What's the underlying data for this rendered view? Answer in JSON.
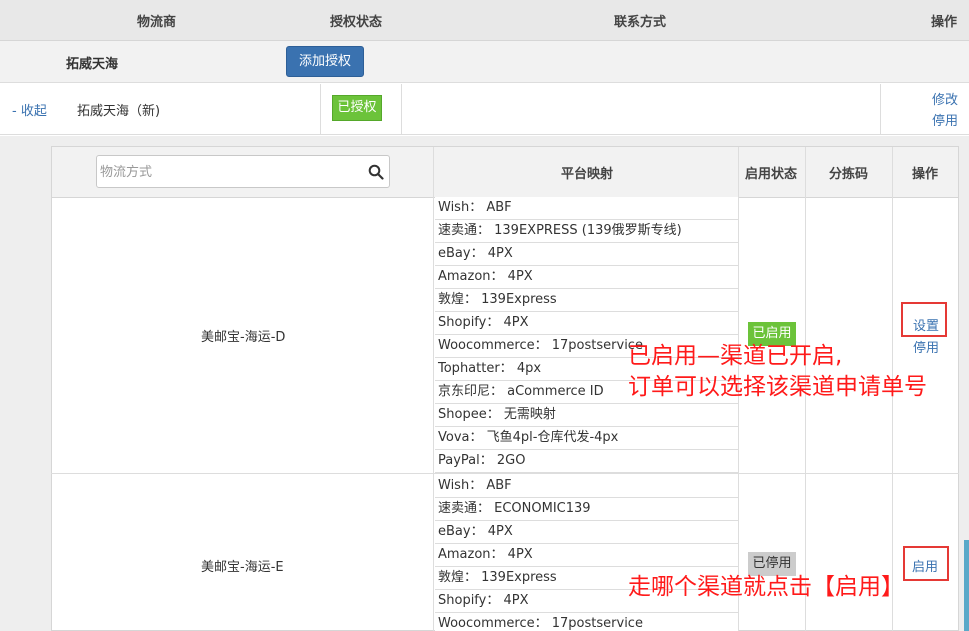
{
  "header": {
    "col_vendor": "物流商",
    "col_auth_status": "授权状态",
    "col_contact": "联系方式",
    "col_action": "操作"
  },
  "vendor": {
    "name": "拓威天海",
    "add_auth_label": "添加授权"
  },
  "account": {
    "collapse_label": "- 收起",
    "name": "拓威天海（新)",
    "auth_badge": "已授权",
    "edit_label": "修改",
    "disable_label": "停用"
  },
  "inner_header": {
    "search_placeholder": "物流方式",
    "col_mapping": "平台映射",
    "col_enable_status": "启用状态",
    "col_sort_code": "分拣码",
    "col_action": "操作"
  },
  "channels": [
    {
      "name": "美邮宝-海运-D",
      "status": "已启用",
      "action_primary": "设置",
      "action_secondary": "停用",
      "mappings": [
        "Wish： ABF",
        "速卖通： 139EXPRESS (139俄罗斯专线)",
        "eBay： 4PX",
        "Amazon： 4PX",
        "敦煌： 139Express",
        "Shopify： 4PX",
        "Woocommerce： 17postservice",
        "Tophatter： 4px",
        "京东印尼： aCommerce ID",
        "Shopee： 无需映射",
        "Vova： 飞鱼4pl-仓库代发-4px",
        "PayPal： 2GO"
      ]
    },
    {
      "name": "美邮宝-海运-E",
      "status": "已停用",
      "action_primary": "启用",
      "mappings": [
        "Wish： ABF",
        "速卖通： ECONOMIC139",
        "eBay： 4PX",
        "Amazon： 4PX",
        "敦煌： 139Express",
        "Shopify： 4PX",
        "Woocommerce： 17postservice"
      ]
    }
  ],
  "annotations": {
    "note1_line1": "已启用—渠道已开启,",
    "note1_line2": "订单可以选择该渠道申请单号",
    "note2": "走哪个渠道就点击【启用】"
  },
  "colors": {
    "link": "#3a72b0",
    "enabled_badge": "#6cc33a",
    "disabled_badge": "#cccccc",
    "annotation": "#ff1a1a",
    "button": "#3a72b0"
  }
}
